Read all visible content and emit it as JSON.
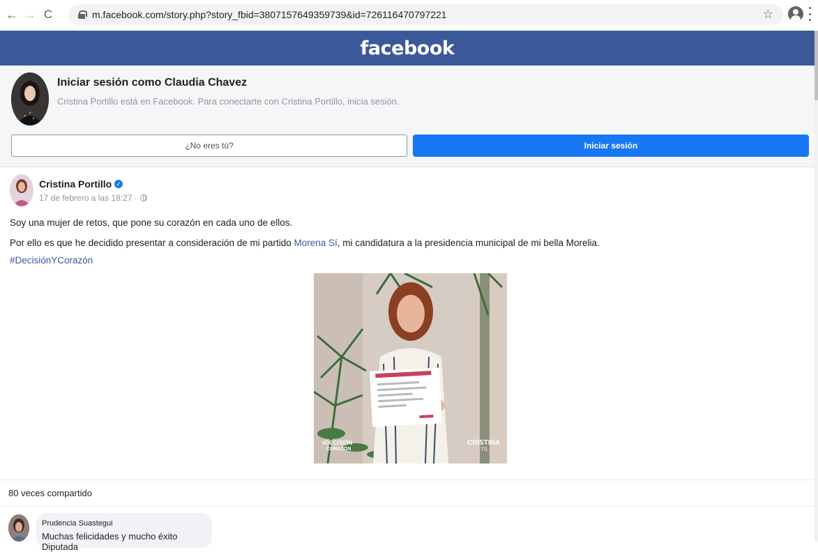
{
  "browser": {
    "url": "m.facebook.com/story.php?story_fbid=3807157649359739&id=726116470797221",
    "back_glyph": "←",
    "forward_glyph": "→",
    "reload_glyph": "C",
    "star_glyph": "☆"
  },
  "header": {
    "logo": "facebook"
  },
  "login_prompt": {
    "title": "Iniciar sesión como Claudia Chavez",
    "subtitle": "Cristina Portillo está en Facebook. Para conectarte con Cristina Portillo, inicia sesión.",
    "not_you_label": "¿No eres tú?",
    "login_label": "Iniciar sesión"
  },
  "post": {
    "author": "Cristina Portillo",
    "verified_glyph": "✓",
    "date": "17 de febrero a las 18:27 ·",
    "line1": "Soy una mujer de retos, que pone su corazón en cada uno de ellos.",
    "line2_before": "Por ello es que he decidido presentar a consideración de mi partido ",
    "line2_link": "Morena Sí",
    "line2_after": ", mi candidatura a la presidencia municipal de mi bella Morelia.",
    "hashtag": "#DecisiónYCorazón",
    "image_caption_left": "#DECISIÓN\nCORAZÓN",
    "image_caption_right": "CRISTINA\nPORTILLO"
  },
  "shares": {
    "label": "80 veces compartido"
  },
  "comment": {
    "author": "Prudencia Suastegui",
    "text": "Muchas felicidades y mucho éxito Diputada"
  },
  "colors": {
    "fb_blue": "#3b5998",
    "button_blue": "#1877f2",
    "link": "#385898"
  }
}
